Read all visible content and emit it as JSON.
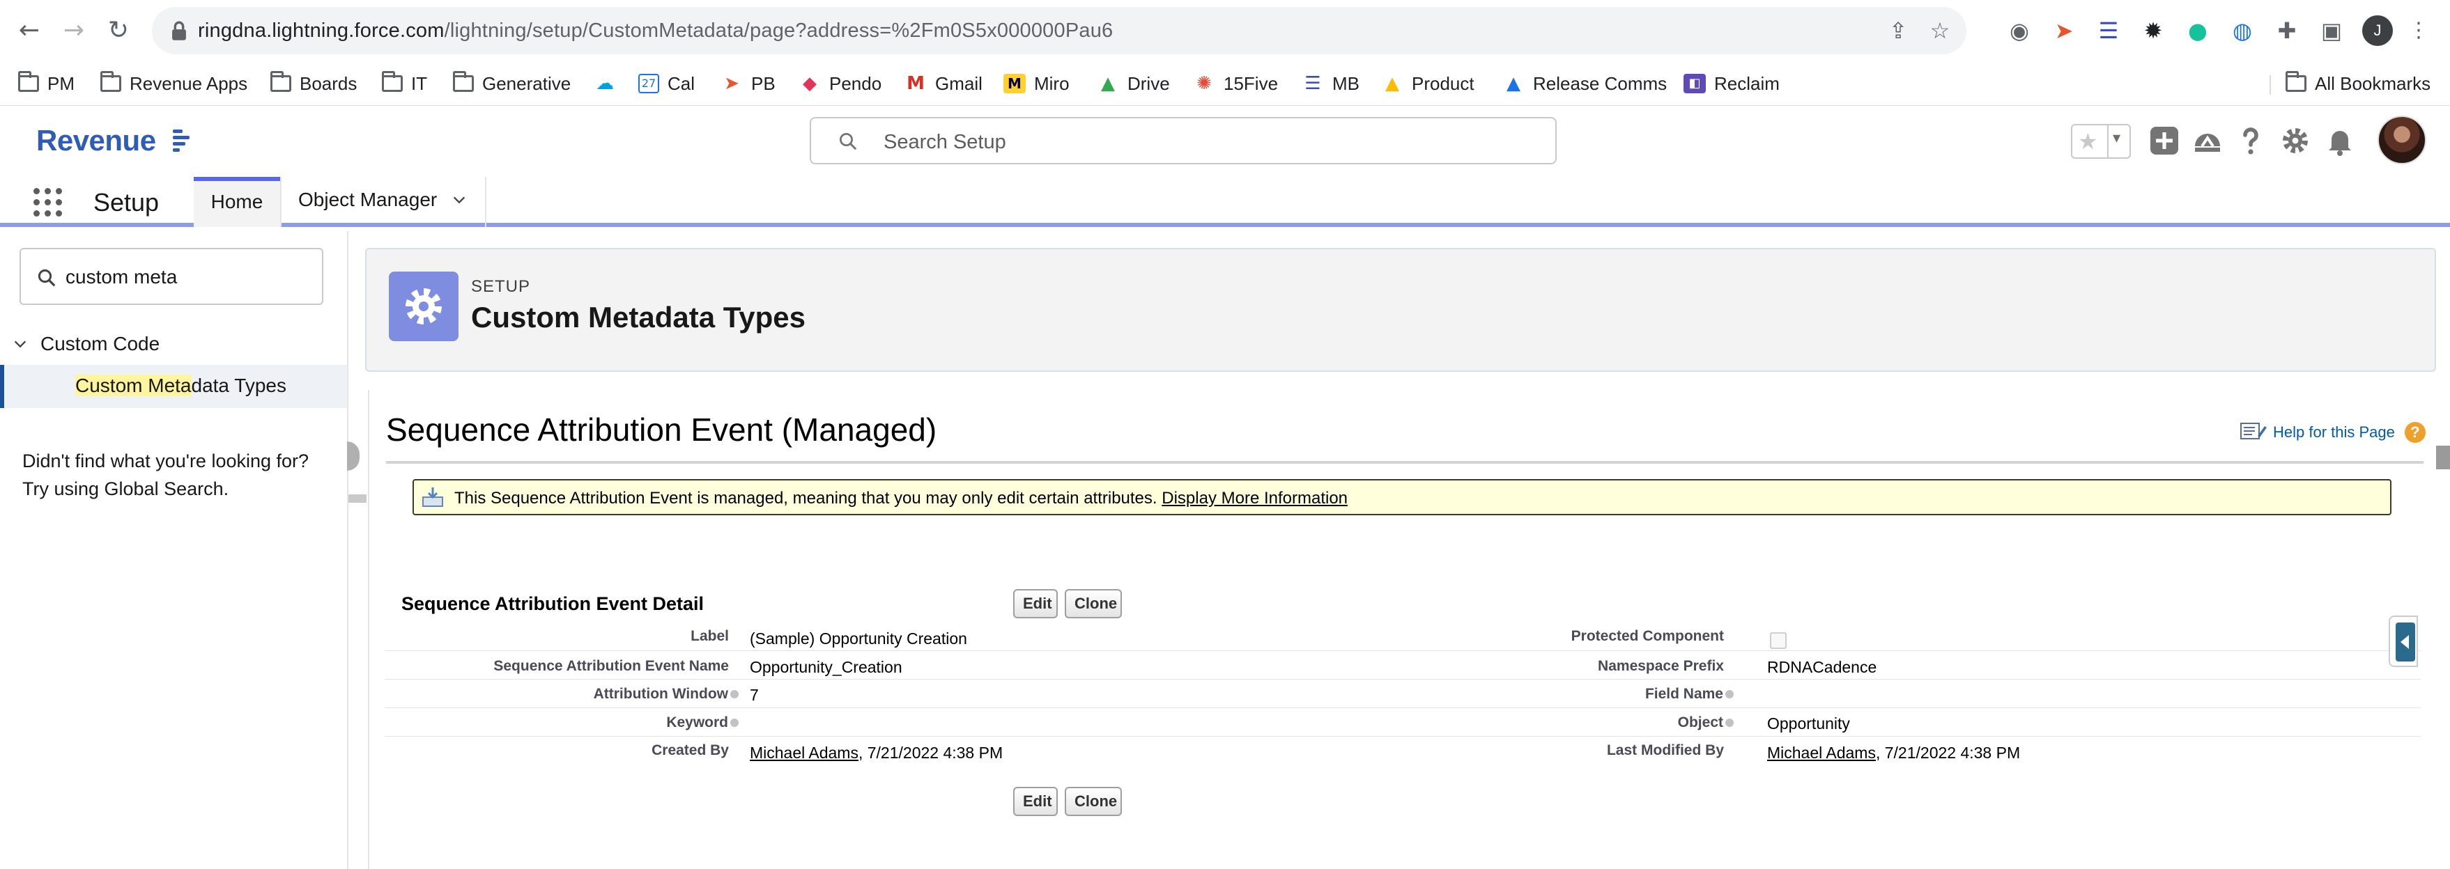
{
  "browser": {
    "url_domain": "ringdna.lightning.force.com",
    "url_path": "/lightning/setup/CustomMetadata/page?address=%2Fm0S5x000000Pau6",
    "profile_initial": "J"
  },
  "bookmarks": [
    {
      "label": "PM",
      "icon": "folder-icon"
    },
    {
      "label": "Revenue Apps",
      "icon": "folder-icon"
    },
    {
      "label": "Boards",
      "icon": "folder-icon"
    },
    {
      "label": "IT",
      "icon": "folder-icon"
    },
    {
      "label": "Generative",
      "icon": "folder-icon"
    },
    {
      "label": "",
      "icon": "salesforce-cloud-icon"
    },
    {
      "label": "Cal",
      "icon": "calendar-icon"
    },
    {
      "label": "PB",
      "icon": "pb-icon"
    },
    {
      "label": "Pendo",
      "icon": "pendo-icon"
    },
    {
      "label": "Gmail",
      "icon": "gmail-icon"
    },
    {
      "label": "Miro",
      "icon": "miro-icon"
    },
    {
      "label": "Drive",
      "icon": "drive-icon"
    },
    {
      "label": "15Five",
      "icon": "15five-icon"
    },
    {
      "label": "MB",
      "icon": "mb-icon"
    },
    {
      "label": "Product",
      "icon": "drive-icon"
    },
    {
      "label": "Release Comms",
      "icon": "drive-icon"
    },
    {
      "label": "Reclaim",
      "icon": "reclaim-icon"
    }
  ],
  "all_bookmarks_label": "All Bookmarks",
  "header": {
    "logo_text": "Revenue",
    "search_placeholder": "Search Setup"
  },
  "nav": {
    "app_name": "Setup",
    "tabs": [
      {
        "label": "Home",
        "active": true
      },
      {
        "label": "Object Manager",
        "active": false
      }
    ]
  },
  "sidebar": {
    "quick_find_value": "custom meta",
    "category": "Custom Code",
    "item_match": "Custom Meta",
    "item_rest": "data Types",
    "no_results_help": "Didn't find what you're looking for? Try using Global Search."
  },
  "setup_header": {
    "eyebrow": "SETUP",
    "title": "Custom Metadata Types"
  },
  "page": {
    "title": "Sequence Attribution Event (Managed)",
    "help_link": "Help for this Page",
    "managed_message": "This Sequence Attribution Event is managed, meaning that you may only edit certain attributes.",
    "managed_link": "Display More Information",
    "detail_section_title": "Sequence Attribution Event Detail",
    "edit_label": "Edit",
    "clone_label": "Clone"
  },
  "detail": {
    "left": [
      {
        "label": "Label",
        "value": "(Sample) Opportunity Creation",
        "info": false
      },
      {
        "label": "Sequence Attribution Event Name",
        "value": "Opportunity_Creation",
        "info": false
      },
      {
        "label": "Attribution Window",
        "value": "7",
        "info": true
      },
      {
        "label": "Keyword",
        "value": "",
        "info": true
      },
      {
        "label": "Created By",
        "value_link": "Michael Adams",
        "value": ", 7/21/2022 4:38 PM",
        "info": false
      }
    ],
    "right": [
      {
        "label": "Protected Component",
        "checkbox": true,
        "checked": false,
        "info": false
      },
      {
        "label": "Namespace Prefix",
        "value": "RDNACadence",
        "info": false
      },
      {
        "label": "Field Name",
        "value": "",
        "info": true
      },
      {
        "label": "Object",
        "value": "Opportunity",
        "info": true
      },
      {
        "label": "Last Modified By",
        "value_link": "Michael Adams",
        "value": ", 7/21/2022 4:38 PM",
        "info": false
      }
    ]
  },
  "colors": {
    "brand_blue": "#2f5cb4",
    "setup_icon": "#7f8de1",
    "nav_accent": "#5867e8",
    "message_bg": "#ffffdc"
  }
}
